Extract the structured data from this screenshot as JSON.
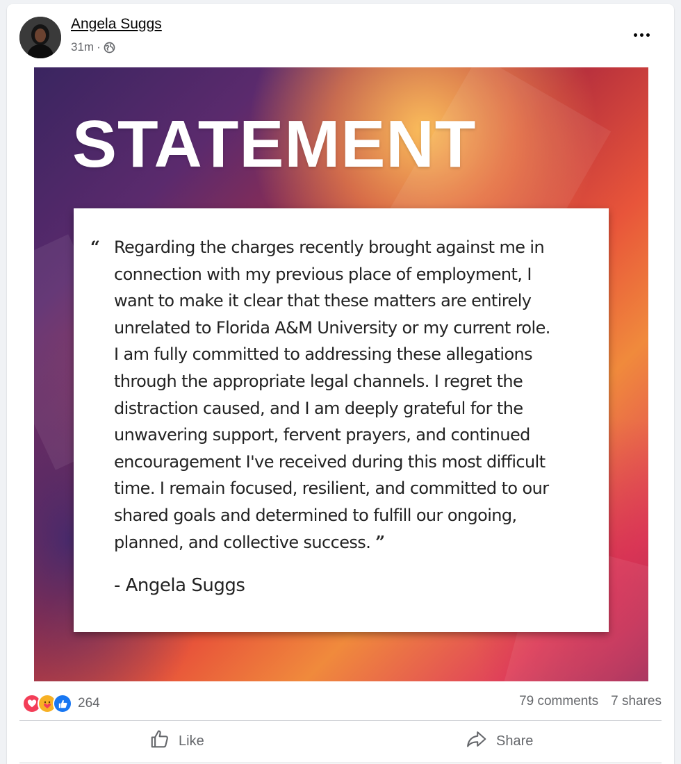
{
  "post": {
    "author": "Angela Suggs",
    "time": "31m",
    "separator": "·",
    "privacy_icon": "globe-icon",
    "more_icon": "more-options-icon"
  },
  "image": {
    "title": "STATEMENT",
    "quote_lines": [
      "Regarding the charges recently brought against me in",
      "connection with my previous place of employment, I",
      "want to make it clear that these matters are entirely",
      "unrelated to Florida A&M University or my current role.",
      "I am fully committed to addressing these allegations",
      "through the appropriate legal channels. I regret the",
      "distraction caused, and I am deeply grateful for the",
      "unwavering support, fervent prayers, and continued",
      "encouragement I've received during this most difficult",
      "time. I remain focused, resilient, and committed to our",
      "shared goals and determined to fulfill our ongoing,",
      "planned, and collective success."
    ],
    "open_quote": "“",
    "close_quote": "”",
    "signature": "-  Angela Suggs"
  },
  "stats": {
    "reactions": [
      "love-reaction-icon",
      "care-reaction-icon",
      "like-reaction-icon"
    ],
    "reaction_count": "264",
    "comments": "79 comments",
    "shares": "7 shares"
  },
  "actions": {
    "like_label": "Like",
    "share_label": "Share"
  },
  "colors": {
    "like_blue": "#1877f2",
    "love_red": "#f33e58",
    "care_yellow": "#f7b125",
    "secondary_text": "#65676b"
  }
}
